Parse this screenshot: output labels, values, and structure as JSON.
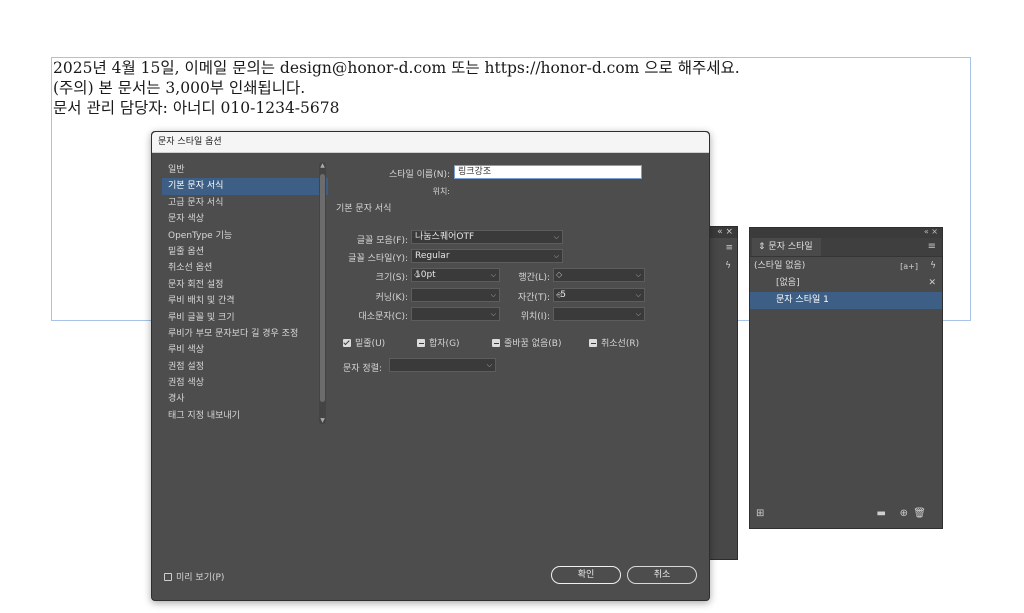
{
  "document": {
    "lines": [
      "2025년 4월 15일, 이메일 문의는 design@honor-d.com 또는 https://honor-d.com 으로 해주세요.",
      "(주의) 본 문서는 3,000부 인쇄됩니다.",
      "문서 관리 담당자: 아너디 010-1234-5678"
    ]
  },
  "dialog": {
    "title": "문자 스타일 옵션",
    "nav": [
      "일반",
      "기본 문자 서식",
      "고급 문자 서식",
      "문자 색상",
      "OpenType 기능",
      "밑줄 옵션",
      "취소선 옵션",
      "문자 회전 설정",
      "루비 배치 및 간격",
      "루비 글꼴 및 크기",
      "루비가 부모 문자보다 길 경우 조정",
      "루비 색상",
      "권점 설정",
      "권점 색상",
      "경사",
      "태그 지정 내보내기"
    ],
    "selected_nav": "기본 문자 서식",
    "style_name_label": "스타일 이름(N):",
    "style_name_value": "링크강조",
    "location_label": "위치:",
    "section_title": "기본 문자 서식",
    "font_family_label": "글꼴 모음(F):",
    "font_family_value": "나눔스퀘어OTF",
    "font_style_label": "글꼴 스타일(Y):",
    "font_style_value": "Regular",
    "size_label": "크기(S):",
    "size_value": "10pt",
    "leading_label": "행간(L):",
    "leading_value": "",
    "kerning_label": "커닝(K):",
    "kerning_value": "",
    "tracking_label": "자간(T):",
    "tracking_value": "-5",
    "case_label": "대소문자(C):",
    "case_value": "",
    "position_label": "위치(I):",
    "position_value": "",
    "checkboxes": [
      {
        "label": "밑줄(U)",
        "state": "checked"
      },
      {
        "label": "합자(G)",
        "state": "mixed"
      },
      {
        "label": "줄바꿈 없음(B)",
        "state": "mixed"
      },
      {
        "label": "취소선(R)",
        "state": "mixed"
      }
    ],
    "alignment_label": "문자 정렬:",
    "alignment_value": "",
    "preview_label": "미리 보기(P)",
    "ok_label": "확인",
    "cancel_label": "취소"
  },
  "char_styles_panel": {
    "tab_label": "문자 스타일",
    "items": [
      {
        "label": "(스타일 없음)",
        "selected": false
      },
      {
        "label": "[없음]",
        "selected": false
      },
      {
        "label": "문자 스타일 1",
        "selected": true
      }
    ]
  }
}
